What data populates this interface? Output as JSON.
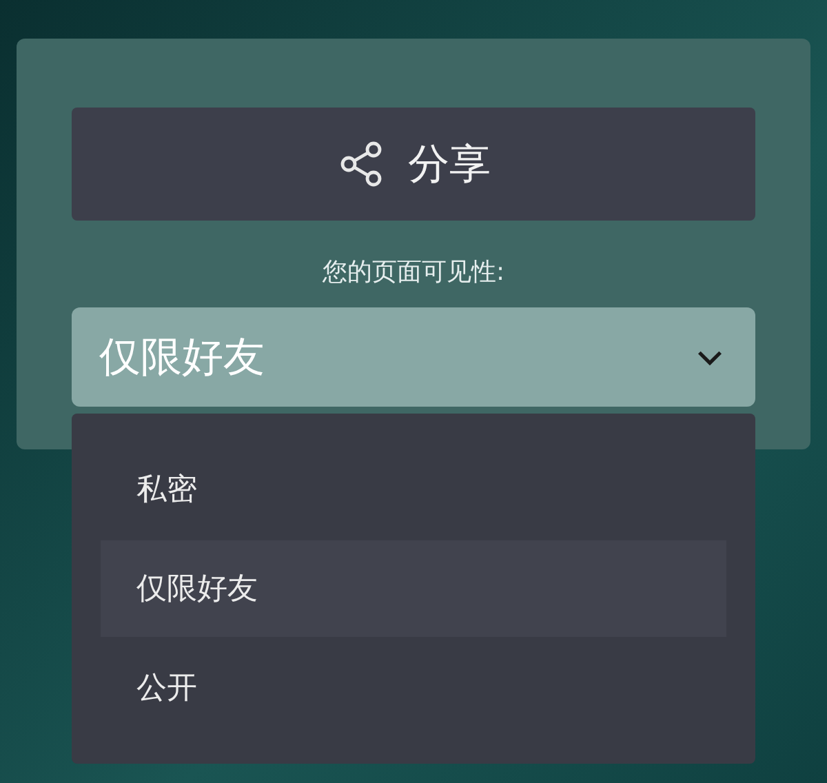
{
  "share_button": {
    "label": "分享"
  },
  "visibility": {
    "label": "您的页面可见性:",
    "value": "仅限好友",
    "expanded": true
  },
  "options": [
    {
      "label": "私密",
      "selected": false
    },
    {
      "label": "仅限好友",
      "selected": true
    },
    {
      "label": "公开",
      "selected": false
    }
  ]
}
